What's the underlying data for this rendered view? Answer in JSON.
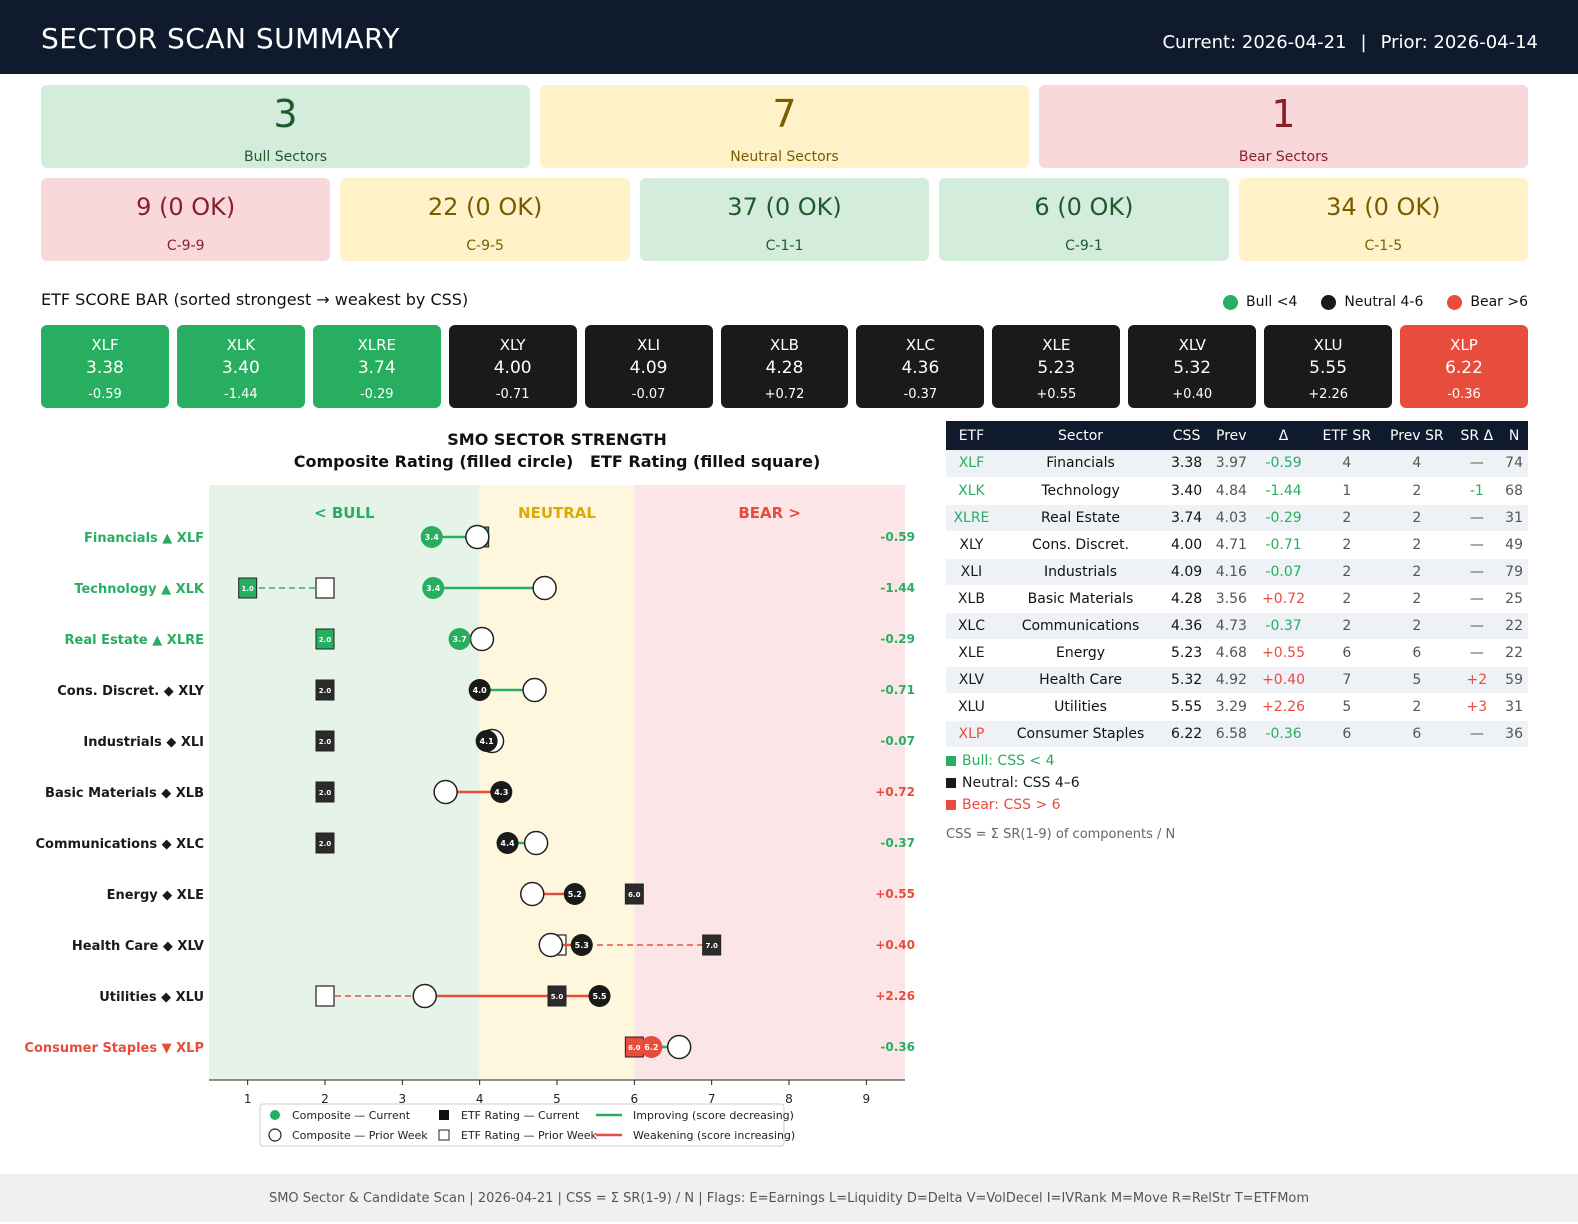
{
  "header": {
    "title": "SECTOR SCAN SUMMARY",
    "current": "Current: 2026-04-21",
    "separator": "|",
    "prior": "Prior: 2026-04-14"
  },
  "summary": [
    {
      "value": "3",
      "label": "Bull Sectors",
      "tone": "bull"
    },
    {
      "value": "7",
      "label": "Neutral Sectors",
      "tone": "neutral"
    },
    {
      "value": "1",
      "label": "Bear Sectors",
      "tone": "bear"
    }
  ],
  "scans": [
    {
      "value": "9 (0 OK)",
      "label": "C-9-9",
      "tone": "bear"
    },
    {
      "value": "22 (0 OK)",
      "label": "C-9-5",
      "tone": "neutral"
    },
    {
      "value": "37 (0 OK)",
      "label": "C-1-1",
      "tone": "bull"
    },
    {
      "value": "6 (0 OK)",
      "label": "C-9-1",
      "tone": "bull"
    },
    {
      "value": "34 (0 OK)",
      "label": "C-1-5",
      "tone": "neutral"
    }
  ],
  "score_bar": {
    "title": "ETF SCORE BAR  (sorted strongest → weakest by CSS)",
    "legend": [
      {
        "label": "Bull <4",
        "color": "#27ae60"
      },
      {
        "label": "Neutral 4-6",
        "color": "#1a1a1a"
      },
      {
        "label": "Bear >6",
        "color": "#e74c3c"
      }
    ],
    "tiles": [
      {
        "sym": "XLF",
        "css": "3.38",
        "chg": "-0.59",
        "tone": "g"
      },
      {
        "sym": "XLK",
        "css": "3.40",
        "chg": "-1.44",
        "tone": "g"
      },
      {
        "sym": "XLRE",
        "css": "3.74",
        "chg": "-0.29",
        "tone": "g"
      },
      {
        "sym": "XLY",
        "css": "4.00",
        "chg": "-0.71",
        "tone": "k"
      },
      {
        "sym": "XLI",
        "css": "4.09",
        "chg": "-0.07",
        "tone": "k"
      },
      {
        "sym": "XLB",
        "css": "4.28",
        "chg": "+0.72",
        "tone": "k"
      },
      {
        "sym": "XLC",
        "css": "4.36",
        "chg": "-0.37",
        "tone": "k"
      },
      {
        "sym": "XLE",
        "css": "5.23",
        "chg": "+0.55",
        "tone": "k"
      },
      {
        "sym": "XLV",
        "css": "5.32",
        "chg": "+0.40",
        "tone": "k"
      },
      {
        "sym": "XLU",
        "css": "5.55",
        "chg": "+2.26",
        "tone": "k"
      },
      {
        "sym": "XLP",
        "css": "6.22",
        "chg": "-0.36",
        "tone": "r"
      }
    ]
  },
  "chart_data": {
    "type": "scatter",
    "title": "SMO SECTOR STRENGTH",
    "subtitle": "Composite Rating (filled circle)   ETF Rating (filled square)",
    "zones": [
      {
        "label": "< BULL",
        "from": 0.5,
        "to": 4,
        "color": "#e6f3e8",
        "text_color": "#27ae60"
      },
      {
        "label": "NEUTRAL",
        "from": 4,
        "to": 6,
        "color": "#fff7dd",
        "text_color": "#e0a800"
      },
      {
        "label": "BEAR >",
        "from": 6,
        "to": 9.5,
        "color": "#fbe5e6",
        "text_color": "#e74c3c"
      }
    ],
    "xlim": [
      0.5,
      9.5
    ],
    "xticks": [
      "1",
      "2",
      "3",
      "4",
      "5",
      "6",
      "7",
      "8",
      "9"
    ],
    "rows": [
      {
        "label": "Financials ▲ XLF",
        "state": "bull",
        "comp_cur": 3.38,
        "comp_prior": 3.97,
        "etf_cur": 4.0,
        "etf_prior": 4.0,
        "comp_cur_label": "3.4",
        "etf_cur_label": "4.0",
        "delta": "-0.59"
      },
      {
        "label": "Technology ▲ XLK",
        "state": "bull",
        "comp_cur": 3.4,
        "comp_prior": 4.84,
        "etf_cur": 1.0,
        "etf_prior": 2.0,
        "comp_cur_label": "3.4",
        "etf_cur_label": "1.0",
        "delta": "-1.44"
      },
      {
        "label": "Real Estate ▲ XLRE",
        "state": "bull",
        "comp_cur": 3.74,
        "comp_prior": 4.03,
        "etf_cur": 2.0,
        "etf_prior": 2.0,
        "comp_cur_label": "3.7",
        "etf_cur_label": "2.0",
        "delta": "-0.29"
      },
      {
        "label": "Cons. Discret. ◆ XLY",
        "state": "neutral",
        "comp_cur": 4.0,
        "comp_prior": 4.71,
        "etf_cur": 2.0,
        "etf_prior": 2.0,
        "comp_cur_label": "4.0",
        "etf_cur_label": "2.0",
        "delta": "-0.71"
      },
      {
        "label": "Industrials ◆ XLI",
        "state": "neutral",
        "comp_cur": 4.09,
        "comp_prior": 4.16,
        "etf_cur": 2.0,
        "etf_prior": 2.0,
        "comp_cur_label": "4.1",
        "etf_cur_label": "2.0",
        "delta": "-0.07"
      },
      {
        "label": "Basic Materials ◆ XLB",
        "state": "neutral",
        "comp_cur": 4.28,
        "comp_prior": 3.56,
        "etf_cur": 2.0,
        "etf_prior": 2.0,
        "comp_cur_label": "4.3",
        "etf_cur_label": "2.0",
        "delta": "+0.72"
      },
      {
        "label": "Communications ◆ XLC",
        "state": "neutral",
        "comp_cur": 4.36,
        "comp_prior": 4.73,
        "etf_cur": 2.0,
        "etf_prior": 2.0,
        "comp_cur_label": "4.4",
        "etf_cur_label": "2.0",
        "delta": "-0.37"
      },
      {
        "label": "Energy ◆ XLE",
        "state": "neutral",
        "comp_cur": 5.23,
        "comp_prior": 4.68,
        "etf_cur": 6.0,
        "etf_prior": 6.0,
        "comp_cur_label": "5.2",
        "etf_cur_label": "6.0",
        "delta": "+0.55"
      },
      {
        "label": "Health Care ◆ XLV",
        "state": "neutral",
        "comp_cur": 5.32,
        "comp_prior": 4.92,
        "etf_cur": 7.0,
        "etf_prior": 5.0,
        "comp_cur_label": "5.3",
        "etf_cur_label": "7.0",
        "delta": "+0.40"
      },
      {
        "label": "Utilities ◆ XLU",
        "state": "neutral",
        "comp_cur": 5.55,
        "comp_prior": 3.29,
        "etf_cur": 5.0,
        "etf_prior": 2.0,
        "comp_cur_label": "5.5",
        "etf_cur_label": "5.0",
        "delta": "+2.26"
      },
      {
        "label": "Consumer Staples ▼ XLP",
        "state": "bear",
        "comp_cur": 6.22,
        "comp_prior": 6.58,
        "etf_cur": 6.0,
        "etf_prior": 6.0,
        "comp_cur_label": "6.2",
        "etf_cur_label": "6.0",
        "delta": "-0.36"
      }
    ],
    "legend": [
      {
        "label": "Composite — Current",
        "marker": "filled-circle"
      },
      {
        "label": "Composite — Prior Week",
        "marker": "open-circle"
      },
      {
        "label": "ETF Rating — Current",
        "marker": "filled-square"
      },
      {
        "label": "ETF Rating — Prior Week",
        "marker": "open-square"
      },
      {
        "label": "Improving (score decreasing)",
        "marker": "green-line"
      },
      {
        "label": "Weakening (score increasing)",
        "marker": "red-line"
      }
    ],
    "colors": {
      "bull": "#27ae60",
      "neutral": "#1a1a1a",
      "bear": "#e74c3c",
      "improving": "#27ae60",
      "weakening": "#e74c3c"
    }
  },
  "table": {
    "headers": [
      "ETF",
      "Sector",
      "CSS",
      "Prev",
      "Δ",
      "ETF SR",
      "Prev SR",
      "SR Δ",
      "N"
    ],
    "rows": [
      {
        "etf": "XLF",
        "sector": "Financials",
        "css": "3.38",
        "prev": "3.97",
        "delta": "-0.59",
        "etf_sr": "4",
        "prev_sr": "4",
        "sr_delta": "—",
        "n": "74",
        "tone": "bull"
      },
      {
        "etf": "XLK",
        "sector": "Technology",
        "css": "3.40",
        "prev": "4.84",
        "delta": "-1.44",
        "etf_sr": "1",
        "prev_sr": "2",
        "sr_delta": "-1",
        "n": "68",
        "tone": "bull"
      },
      {
        "etf": "XLRE",
        "sector": "Real Estate",
        "css": "3.74",
        "prev": "4.03",
        "delta": "-0.29",
        "etf_sr": "2",
        "prev_sr": "2",
        "sr_delta": "—",
        "n": "31",
        "tone": "bull"
      },
      {
        "etf": "XLY",
        "sector": "Cons. Discret.",
        "css": "4.00",
        "prev": "4.71",
        "delta": "-0.71",
        "etf_sr": "2",
        "prev_sr": "2",
        "sr_delta": "—",
        "n": "49",
        "tone": "neutral"
      },
      {
        "etf": "XLI",
        "sector": "Industrials",
        "css": "4.09",
        "prev": "4.16",
        "delta": "-0.07",
        "etf_sr": "2",
        "prev_sr": "2",
        "sr_delta": "—",
        "n": "79",
        "tone": "neutral"
      },
      {
        "etf": "XLB",
        "sector": "Basic Materials",
        "css": "4.28",
        "prev": "3.56",
        "delta": "+0.72",
        "etf_sr": "2",
        "prev_sr": "2",
        "sr_delta": "—",
        "n": "25",
        "tone": "neutral"
      },
      {
        "etf": "XLC",
        "sector": "Communications",
        "css": "4.36",
        "prev": "4.73",
        "delta": "-0.37",
        "etf_sr": "2",
        "prev_sr": "2",
        "sr_delta": "—",
        "n": "22",
        "tone": "neutral"
      },
      {
        "etf": "XLE",
        "sector": "Energy",
        "css": "5.23",
        "prev": "4.68",
        "delta": "+0.55",
        "etf_sr": "6",
        "prev_sr": "6",
        "sr_delta": "—",
        "n": "22",
        "tone": "neutral"
      },
      {
        "etf": "XLV",
        "sector": "Health Care",
        "css": "5.32",
        "prev": "4.92",
        "delta": "+0.40",
        "etf_sr": "7",
        "prev_sr": "5",
        "sr_delta": "+2",
        "n": "59",
        "tone": "neutral"
      },
      {
        "etf": "XLU",
        "sector": "Utilities",
        "css": "5.55",
        "prev": "3.29",
        "delta": "+2.26",
        "etf_sr": "5",
        "prev_sr": "2",
        "sr_delta": "+3",
        "n": "31",
        "tone": "neutral"
      },
      {
        "etf": "XLP",
        "sector": "Consumer Staples",
        "css": "6.22",
        "prev": "6.58",
        "delta": "-0.36",
        "etf_sr": "6",
        "prev_sr": "6",
        "sr_delta": "—",
        "n": "36",
        "tone": "bear"
      }
    ],
    "legend": [
      {
        "label": "Bull: CSS < 4",
        "color": "#27ae60"
      },
      {
        "label": "Neutral: CSS 4–6",
        "color": "#1a1a1a"
      },
      {
        "label": "Bear: CSS > 6",
        "color": "#e74c3c"
      }
    ],
    "formula": "CSS = Σ SR(1-9) of components / N"
  },
  "footer": "SMO Sector & Candidate Scan  |  2026-04-21  |  CSS = Σ SR(1-9) / N  |  Flags: E=Earnings  L=Liquidity  D=Delta  V=VolDecel  I=IVRank  M=Move  R=RelStr  T=ETFMom"
}
